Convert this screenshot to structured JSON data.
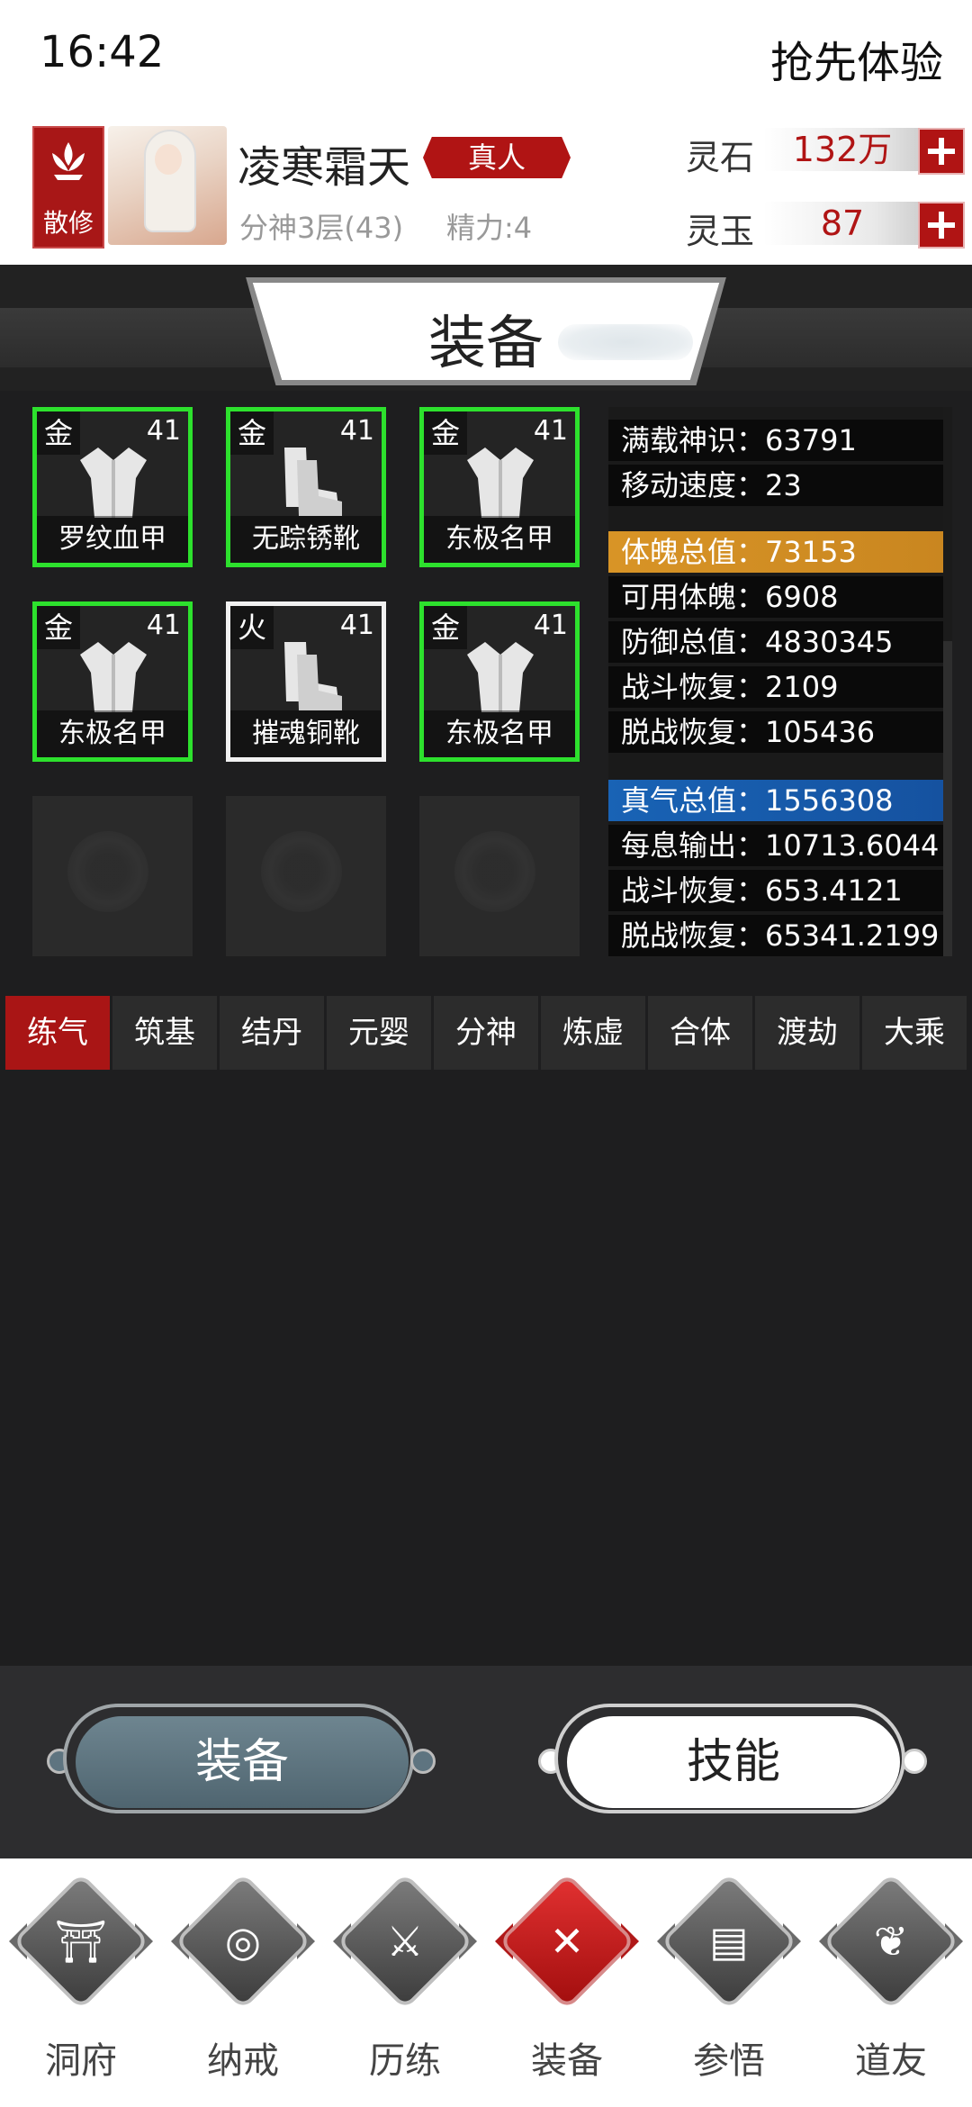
{
  "status_bar": {
    "time": "16:42",
    "trial": "抢先体验"
  },
  "profile": {
    "sect": "散修",
    "name": "凌寒霜天",
    "rank": "真人",
    "realm": "分神3层(43)",
    "energy": "精力:4",
    "resources": [
      {
        "label": "灵石",
        "value": "132万"
      },
      {
        "label": "灵玉",
        "value": "87"
      }
    ]
  },
  "title": "装备",
  "equipment": [
    {
      "element": "金",
      "level": "41",
      "name": "罗纹血甲",
      "kind": "armor-icon",
      "border": "green"
    },
    {
      "element": "金",
      "level": "41",
      "name": "无踪锈靴",
      "kind": "boots-icon",
      "border": "green"
    },
    {
      "element": "金",
      "level": "41",
      "name": "东极名甲",
      "kind": "armor-icon",
      "border": "green"
    },
    {
      "element": "金",
      "level": "41",
      "name": "东极名甲",
      "kind": "armor-icon",
      "border": "green"
    },
    {
      "element": "火",
      "level": "41",
      "name": "摧魂铜靴",
      "kind": "boots-icon",
      "border": "white"
    },
    {
      "element": "金",
      "level": "41",
      "name": "东极名甲",
      "kind": "armor-icon",
      "border": "green"
    }
  ],
  "stats": [
    {
      "text": "满载神识：63791"
    },
    {
      "text": "移动速度：23"
    },
    {
      "text": "体魄总值：73153",
      "style": "gold"
    },
    {
      "text": "可用体魄：6908"
    },
    {
      "text": "防御总值：4830345"
    },
    {
      "text": "战斗恢复：2109"
    },
    {
      "text": "脱战恢复：105436"
    },
    {
      "text": "真气总值：1556308",
      "style": "blue"
    },
    {
      "text": "每息输出：10713.6044"
    },
    {
      "text": "战斗恢复：653.4121"
    },
    {
      "text": "脱战恢复：65341.2199"
    }
  ],
  "realm_tabs": [
    "练气",
    "筑基",
    "结丹",
    "元婴",
    "分神",
    "炼虚",
    "合体",
    "渡劫",
    "大乘"
  ],
  "buttons": {
    "equip": "装备",
    "skill": "技能"
  },
  "nav": [
    {
      "label": "洞府",
      "icon": "gate-icon"
    },
    {
      "label": "纳戒",
      "icon": "ring-icon"
    },
    {
      "label": "历练",
      "icon": "crossed-swords-icon"
    },
    {
      "label": "装备",
      "icon": "close-icon"
    },
    {
      "label": "参悟",
      "icon": "book-icon"
    },
    {
      "label": "道友",
      "icon": "handshake-icon"
    }
  ],
  "colors": {
    "accent_red": "#a91515",
    "slot_green": "#2de12d",
    "gold": "#d89426",
    "blue": "#1963b5"
  }
}
